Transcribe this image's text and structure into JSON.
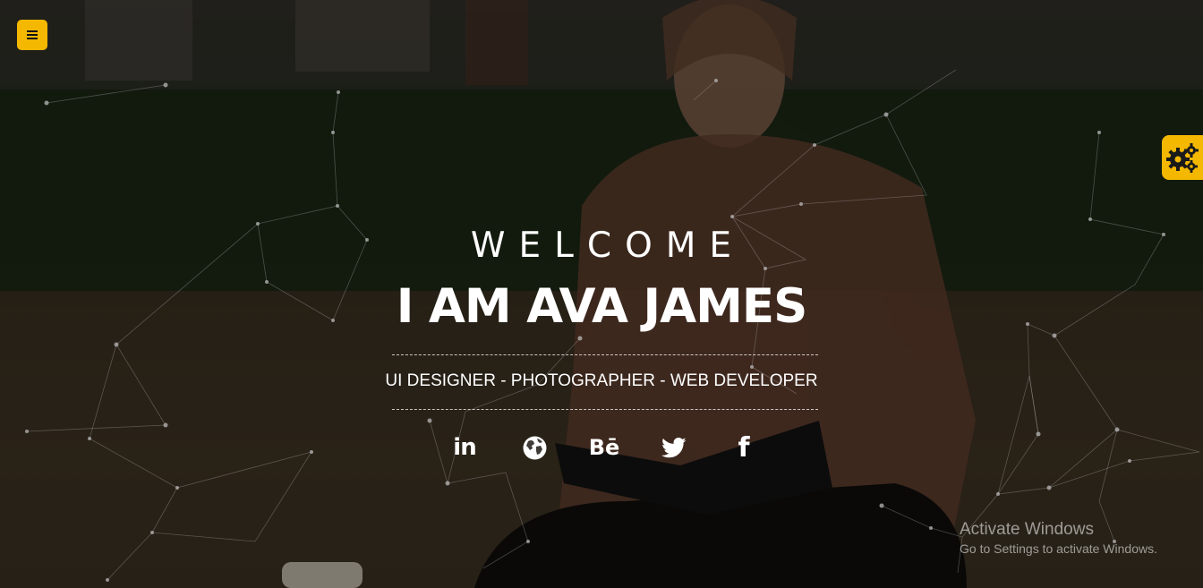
{
  "hero": {
    "welcome": "WELCOME",
    "name": "I AM AVA JAMES",
    "roles": "UI DESIGNER - PHOTOGRAPHER - WEB DEVELOPER"
  },
  "social": [
    {
      "name": "linkedin",
      "icon": "linkedin-icon",
      "glyph": "in"
    },
    {
      "name": "website",
      "icon": "globe-icon"
    },
    {
      "name": "behance",
      "icon": "behance-icon",
      "glyph": "Bē"
    },
    {
      "name": "twitter",
      "icon": "twitter-icon"
    },
    {
      "name": "facebook",
      "icon": "facebook-icon",
      "glyph": "f"
    }
  ],
  "watermark": {
    "title": "Activate Windows",
    "subtitle": "Go to Settings to activate Windows."
  },
  "colors": {
    "accent": "#f5b800",
    "text": "#ffffff"
  },
  "icons": {
    "menu": "hamburger-menu-icon",
    "settings": "gears-icon"
  }
}
